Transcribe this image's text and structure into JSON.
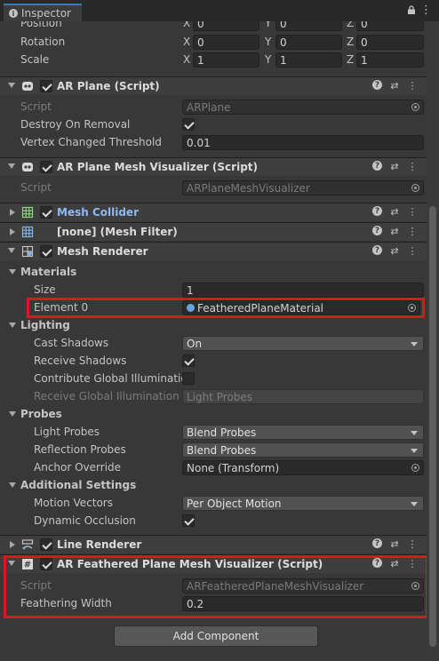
{
  "tab": {
    "title": "Inspector"
  },
  "transform": {
    "position": {
      "label": "Position",
      "x": "0",
      "y": "0",
      "z": "0"
    },
    "rotation": {
      "label": "Rotation",
      "x": "0",
      "y": "0",
      "z": "0"
    },
    "scale": {
      "label": "Scale",
      "x": "1",
      "y": "1",
      "z": "1"
    },
    "axis": {
      "x": "X",
      "y": "Y",
      "z": "Z"
    }
  },
  "ar_plane": {
    "title": "AR Plane (Script)",
    "script_label": "Script",
    "script_value": "ARPlane",
    "destroy_label": "Destroy On Removal",
    "destroy_checked": true,
    "vertex_label": "Vertex Changed Threshold",
    "vertex_value": "0.01"
  },
  "ar_plane_mesh_vis": {
    "title": "AR Plane Mesh Visualizer (Script)",
    "script_label": "Script",
    "script_value": "ARPlaneMeshVisualizer"
  },
  "mesh_collider": {
    "title": "Mesh Collider"
  },
  "mesh_filter": {
    "title": "[none] (Mesh Filter)"
  },
  "mesh_renderer": {
    "title": "Mesh Renderer",
    "materials": {
      "title": "Materials",
      "size_label": "Size",
      "size_value": "1",
      "element_label": "Element 0",
      "element_value": "FeatheredPlaneMaterial"
    },
    "lighting": {
      "title": "Lighting",
      "cast_label": "Cast Shadows",
      "cast_value": "On",
      "receive_label": "Receive Shadows",
      "receive_checked": true,
      "contrib_label": "Contribute Global Illumination",
      "contrib_checked": false,
      "receive_gi_label": "Receive Global Illumination",
      "receive_gi_value": "Light Probes"
    },
    "probes": {
      "title": "Probes",
      "light_label": "Light Probes",
      "light_value": "Blend Probes",
      "reflection_label": "Reflection Probes",
      "reflection_value": "Blend Probes",
      "anchor_label": "Anchor Override",
      "anchor_value": "None (Transform)"
    },
    "additional": {
      "title": "Additional Settings",
      "motion_label": "Motion Vectors",
      "motion_value": "Per Object Motion",
      "occlusion_label": "Dynamic Occlusion",
      "occlusion_checked": true
    }
  },
  "line_renderer": {
    "title": "Line Renderer"
  },
  "ar_feathered": {
    "title": "AR Feathered Plane Mesh Visualizer (Script)",
    "script_label": "Script",
    "script_value": "ARFeatheredPlaneMeshVisualizer",
    "width_label": "Feathering Width",
    "width_value": "0.2"
  },
  "add_component": {
    "label": "Add Component"
  },
  "colors": {
    "highlight": "#e0161c",
    "link": "#8fb9f2",
    "background": "#383838"
  }
}
